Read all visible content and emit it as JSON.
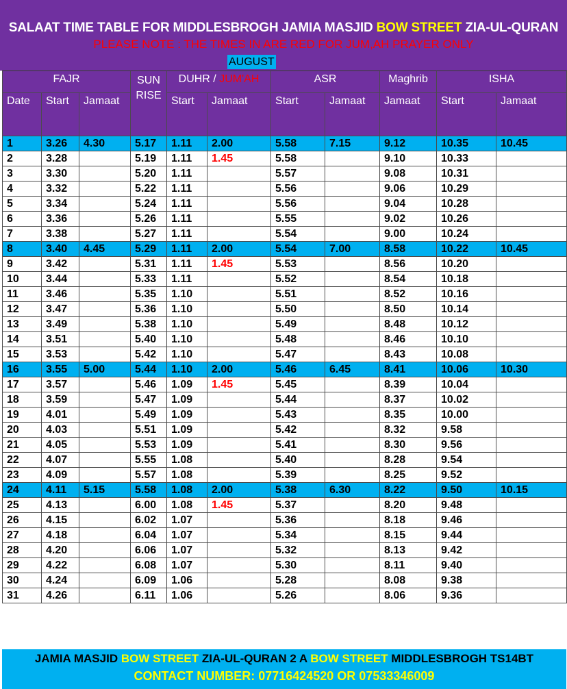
{
  "header": {
    "title_a": "SALAAT TIME TABLE FOR MIDDLESBROGH JAMIA MASJID ",
    "title_b": "BOW STREET",
    "title_c": " ZIA-UL-QURAN",
    "note": "PLEASE NOTE : THE TIMES IN ARE RED FOR JUM,AH PRAYER ONLY",
    "month": "AUGUST"
  },
  "columns": {
    "fajr": "FAJR",
    "sunrise_1": "SUN",
    "sunrise_2": "RISE",
    "duhr": "DUHR / ",
    "jumah": "JUM'AH",
    "asr": "ASR",
    "maghrib": "Maghrib",
    "isha": "ISHA",
    "date": "Date",
    "start": "Start",
    "jamaat": "Jamaat"
  },
  "rows": [
    [
      "1",
      "3.26",
      "4.30",
      "5.17",
      "1.11",
      "2.00",
      "5.58",
      "7.15",
      "9.12",
      "10.35",
      "10.45"
    ],
    [
      "2",
      "3.28",
      "",
      "5.19",
      "1.11",
      "1.45",
      "5.58",
      "",
      "9.10",
      "10.33",
      ""
    ],
    [
      "3",
      "3.30",
      "",
      "5.20",
      "1.11",
      "",
      "5.57",
      "",
      "9.08",
      "10.31",
      ""
    ],
    [
      "4",
      "3.32",
      "",
      "5.22",
      "1.11",
      "",
      "5.56",
      "",
      "9.06",
      "10.29",
      ""
    ],
    [
      "5",
      "3.34",
      "",
      "5.24",
      "1.11",
      "",
      "5.56",
      "",
      "9.04",
      "10.28",
      ""
    ],
    [
      "6",
      "3.36",
      "",
      "5.26",
      "1.11",
      "",
      "5.55",
      "",
      "9.02",
      "10.26",
      ""
    ],
    [
      "7",
      "3.38",
      "",
      "5.27",
      "1.11",
      "",
      "5.54",
      "",
      "9.00",
      "10.24",
      ""
    ],
    [
      "8",
      "3.40",
      "4.45",
      "5.29",
      "1.11",
      "2.00",
      "5.54",
      "7.00",
      "8.58",
      "10.22",
      "10.45"
    ],
    [
      "9",
      "3.42",
      "",
      "5.31",
      "1.11",
      "1.45",
      "5.53",
      "",
      "8.56",
      "10.20",
      ""
    ],
    [
      "10",
      "3.44",
      "",
      "5.33",
      "1.11",
      "",
      "5.52",
      "",
      "8.54",
      "10.18",
      ""
    ],
    [
      "11",
      "3.46",
      "",
      "5.35",
      "1.10",
      "",
      "5.51",
      "",
      "8.52",
      "10.16",
      ""
    ],
    [
      "12",
      "3.47",
      "",
      "5.36",
      "1.10",
      "",
      "5.50",
      "",
      "8.50",
      "10.14",
      ""
    ],
    [
      "13",
      "3.49",
      "",
      "5.38",
      "1.10",
      "",
      "5.49",
      "",
      "8.48",
      "10.12",
      ""
    ],
    [
      "14",
      "3.51",
      "",
      "5.40",
      "1.10",
      "",
      "5.48",
      "",
      "8.46",
      "10.10",
      ""
    ],
    [
      "15",
      "3.53",
      "",
      "5.42",
      "1.10",
      "",
      "5.47",
      "",
      "8.43",
      "10.08",
      ""
    ],
    [
      "16",
      "3.55",
      "5.00",
      "5.44",
      "1.10",
      "2.00",
      "5.46",
      "6.45",
      "8.41",
      "10.06",
      "10.30"
    ],
    [
      "17",
      "3.57",
      "",
      "5.46",
      "1.09",
      "1.45",
      "5.45",
      "",
      "8.39",
      "10.04",
      ""
    ],
    [
      "18",
      "3.59",
      "",
      "5.47",
      "1.09",
      "",
      "5.44",
      "",
      "8.37",
      "10.02",
      ""
    ],
    [
      "19",
      "4.01",
      "",
      "5.49",
      "1.09",
      "",
      "5.43",
      "",
      "8.35",
      "10.00",
      ""
    ],
    [
      "20",
      "4.03",
      "",
      "5.51",
      "1.09",
      "",
      "5.42",
      "",
      "8.32",
      "9.58",
      ""
    ],
    [
      "21",
      "4.05",
      "",
      "5.53",
      "1.09",
      "",
      "5.41",
      "",
      "8.30",
      "9.56",
      ""
    ],
    [
      "22",
      "4.07",
      "",
      "5.55",
      "1.08",
      "",
      "5.40",
      "",
      "8.28",
      "9.54",
      ""
    ],
    [
      "23",
      "4.09",
      "",
      "5.57",
      "1.08",
      "",
      "5.39",
      "",
      "8.25",
      "9.52",
      ""
    ],
    [
      "24",
      "4.11",
      "5.15",
      "5.58",
      "1.08",
      "2.00",
      "5.38",
      "6.30",
      "8.22",
      "9.50",
      "10.15"
    ],
    [
      "25",
      "4.13",
      "",
      "6.00",
      "1.08",
      "1.45",
      "5.37",
      "",
      "8.20",
      "9.48",
      ""
    ],
    [
      "26",
      "4.15",
      "",
      "6.02",
      "1.07",
      "",
      "5.36",
      "",
      "8.18",
      "9.46",
      ""
    ],
    [
      "27",
      "4.18",
      "",
      "6.04",
      "1.07",
      "",
      "5.34",
      "",
      "8.15",
      "9.44",
      ""
    ],
    [
      "28",
      "4.20",
      "",
      "6.06",
      "1.07",
      "",
      "5.32",
      "",
      "8.13",
      "9.42",
      ""
    ],
    [
      "29",
      "4.22",
      "",
      "6.08",
      "1.07",
      "",
      "5.30",
      "",
      "8.11",
      "9.40",
      ""
    ],
    [
      "30",
      "4.24",
      "",
      "6.09",
      "1.06",
      "",
      "5.28",
      "",
      "8.08",
      "9.38",
      ""
    ],
    [
      "31",
      "4.26",
      "",
      "6.11",
      "1.06",
      "",
      "5.26",
      "",
      "8.06",
      "9.36",
      ""
    ]
  ],
  "highlight_rows": [
    "1",
    "8",
    "16",
    "24"
  ],
  "footer": {
    "line1_a": "JAMIA MASJID ",
    "line1_b": "BOW STREET",
    "line1_c": "  ZIA-UL-QURAN 2 A ",
    "line1_d": "BOW STREET",
    "line1_e": " MIDDLESBROGH TS14BT",
    "line2": "CONTACT NUMBER: 07716424520 OR 07533346009"
  },
  "colors": {
    "header_purple": "#7030A0",
    "highlight_blue": "#00B0F0",
    "accent_yellow": "#FFFF00",
    "jumah_red": "#FF0000"
  }
}
